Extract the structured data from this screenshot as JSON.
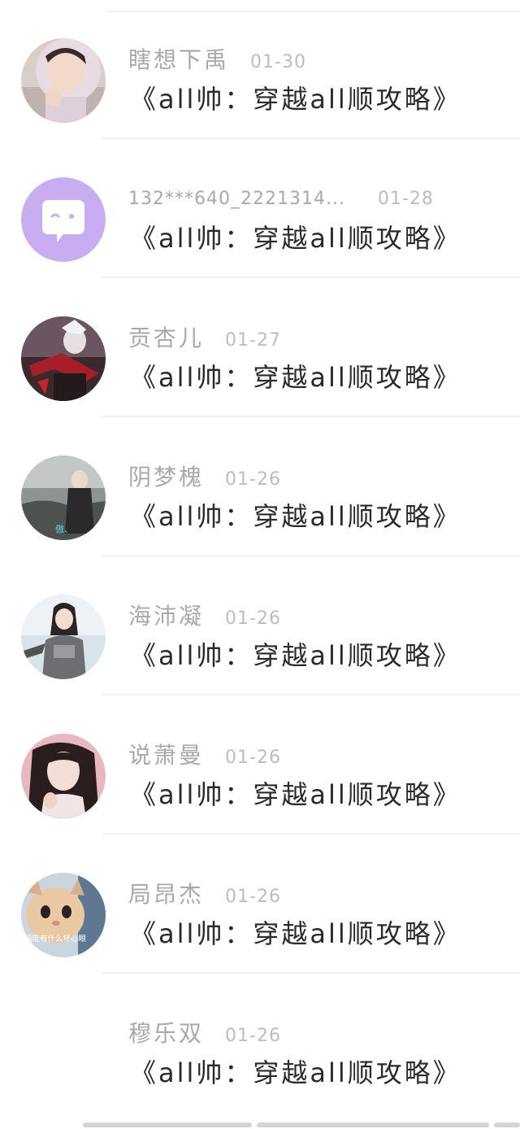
{
  "colors": {
    "name": "#a9a9ad",
    "date": "#bdbdc1",
    "message": "#2a2a2a",
    "divider": "#f1f1f3",
    "avatar_lavender": "#c8aef0"
  },
  "conversations": [
    {
      "name": "瞎想下禹",
      "date": "01-30",
      "message": "《all帅：穿越all顺攻略》",
      "avatar_icon": "user-photo-avatar"
    },
    {
      "name": "132***640_2221314...",
      "date": "01-28",
      "message": "《all帅：穿越all顺攻略》",
      "avatar_icon": "chat-bubble-face-icon"
    },
    {
      "name": "贡杏儿",
      "date": "01-27",
      "message": "《all帅：穿越all顺攻略》",
      "avatar_icon": "user-photo-avatar"
    },
    {
      "name": "阴梦槐",
      "date": "01-26",
      "message": "《all帅：穿越all顺攻略》",
      "avatar_icon": "user-photo-avatar"
    },
    {
      "name": "海沛凝",
      "date": "01-26",
      "message": "《all帅：穿越all顺攻略》",
      "avatar_icon": "user-photo-avatar"
    },
    {
      "name": "说萧曼",
      "date": "01-26",
      "message": "《all帅：穿越all顺攻略》",
      "avatar_icon": "user-photo-avatar"
    },
    {
      "name": "局昂杰",
      "date": "01-26",
      "message": "《all帅：穿越all顺攻略》",
      "avatar_icon": "user-photo-avatar"
    },
    {
      "name": "穆乐双",
      "date": "01-26",
      "message": "《all帅：穿越all顺攻略》",
      "avatar_icon": ""
    }
  ],
  "avatar_captions": {
    "row4": "傲、",
    "row7": "猫能有什么坏心眼"
  }
}
